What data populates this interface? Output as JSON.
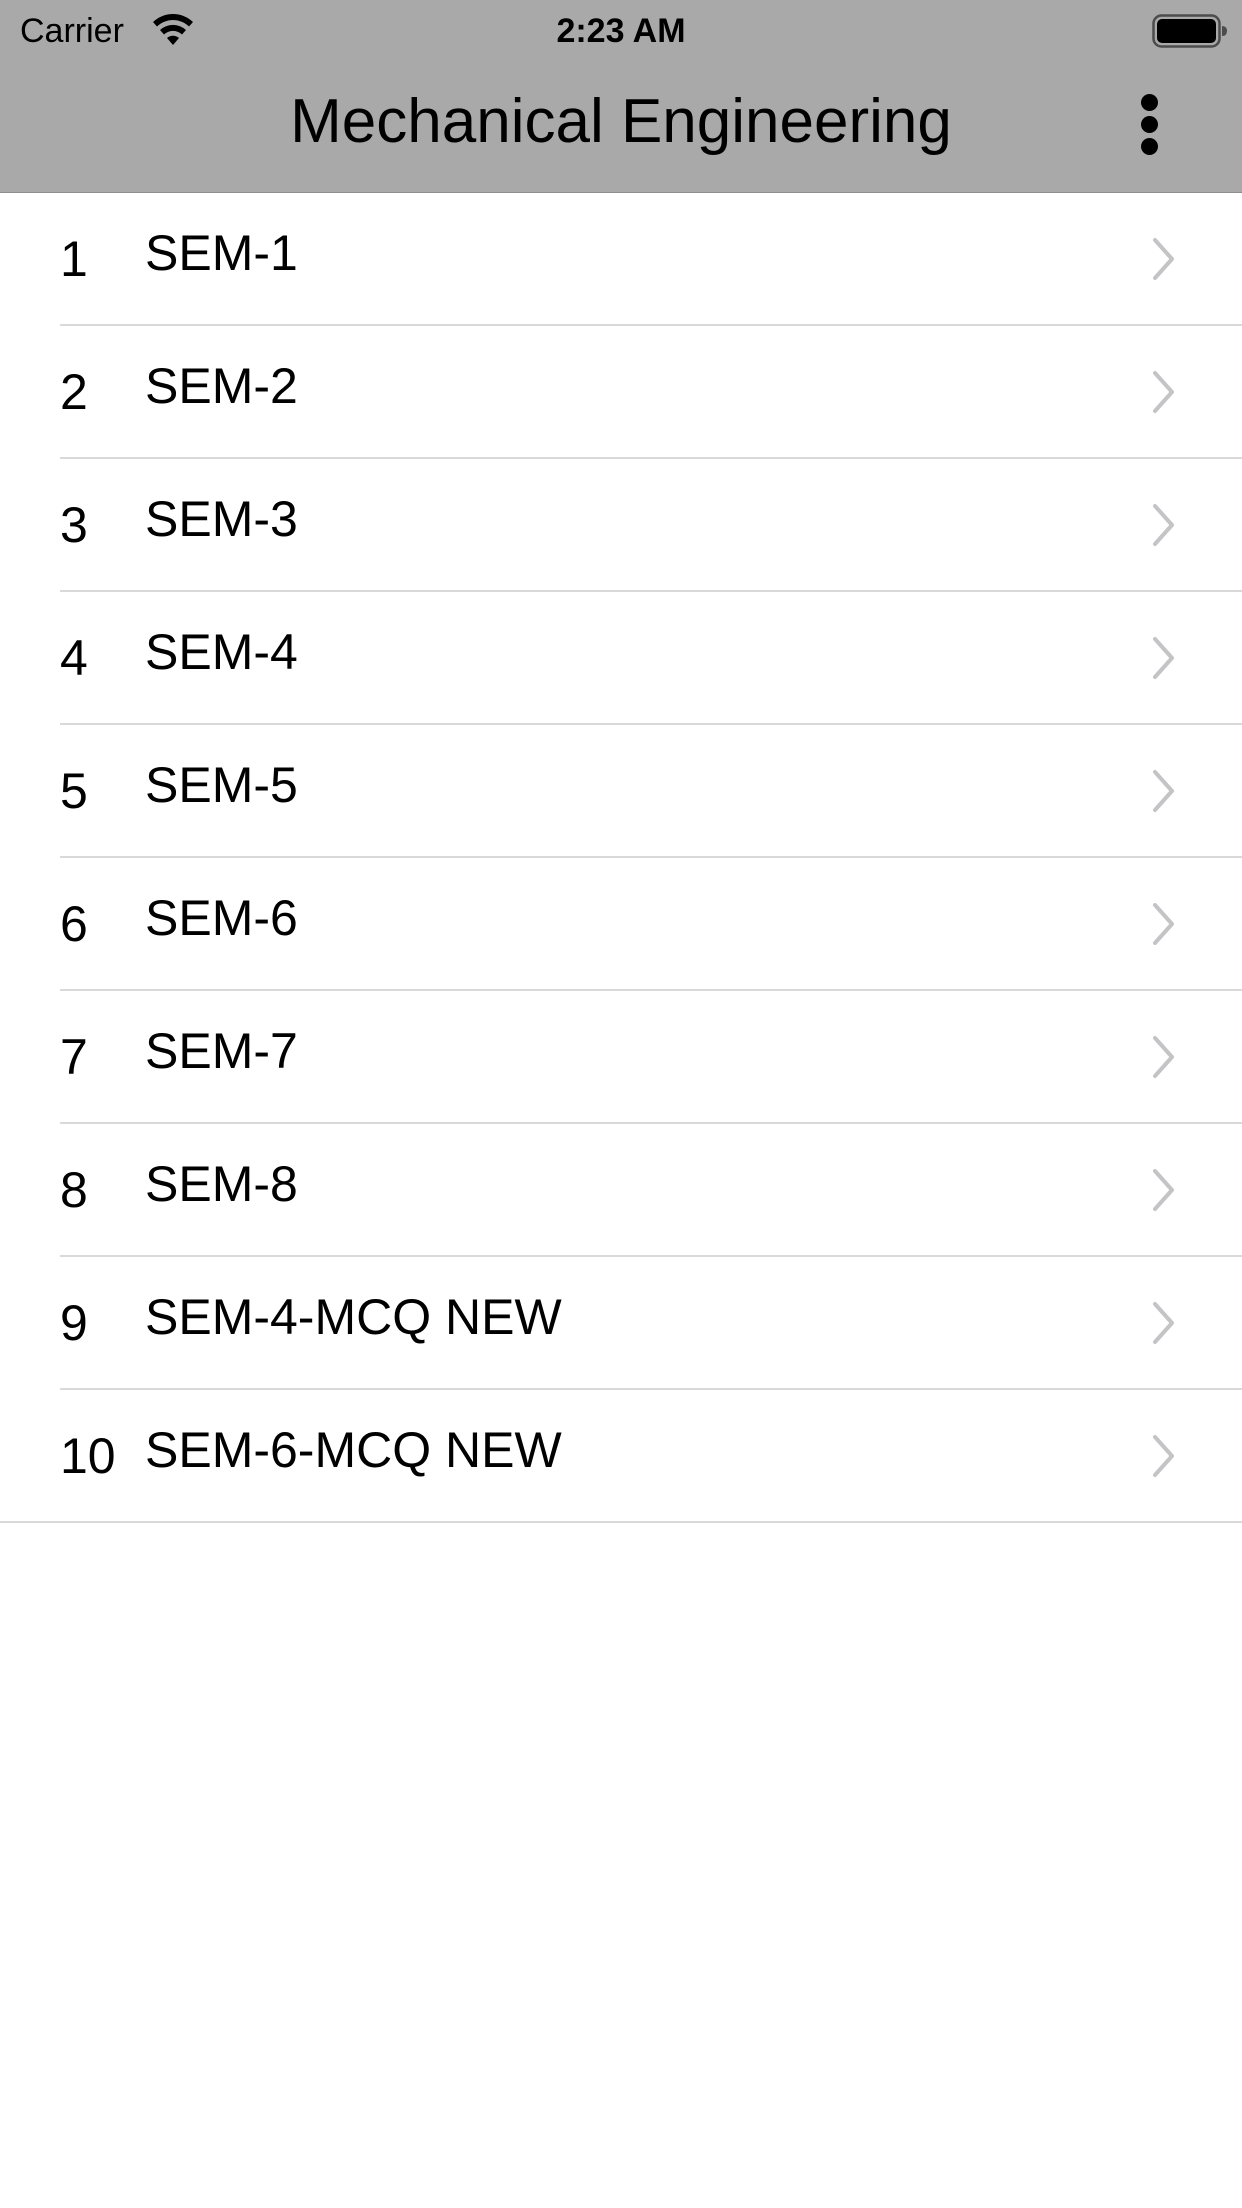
{
  "status_bar": {
    "carrier": "Carrier",
    "time": "2:23 AM",
    "icons": [
      "wifi-icon",
      "battery-icon"
    ]
  },
  "nav_bar": {
    "title": "Mechanical Engineering",
    "more_icon": "vertical-ellipsis-icon",
    "background_color": "#a9a9a9"
  },
  "list": {
    "items": [
      {
        "number": "1",
        "label": "SEM-1"
      },
      {
        "number": "2",
        "label": "SEM-2"
      },
      {
        "number": "3",
        "label": "SEM-3"
      },
      {
        "number": "4",
        "label": "SEM-4"
      },
      {
        "number": "5",
        "label": "SEM-5"
      },
      {
        "number": "6",
        "label": "SEM-6"
      },
      {
        "number": "7",
        "label": "SEM-7"
      },
      {
        "number": "8",
        "label": "SEM-8"
      },
      {
        "number": "9",
        "label": "SEM-4-MCQ NEW"
      },
      {
        "number": "10",
        "label": "SEM-6-MCQ NEW"
      }
    ],
    "accessory_icon": "chevron-right-icon",
    "chevron_color": "#c4c4c7",
    "separator_color": "#d9d9d9"
  }
}
